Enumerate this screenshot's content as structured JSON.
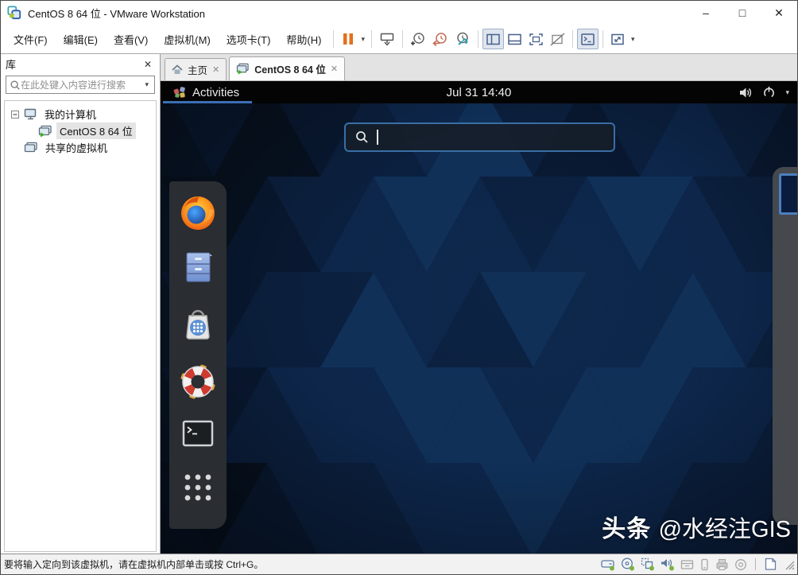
{
  "window": {
    "title": "CentOS 8 64 位 - VMware Workstation",
    "min_glyph": "–",
    "max_glyph": "□",
    "close_glyph": "✕"
  },
  "ui": {
    "close_glyph": "✕",
    "dropdown_glyph": "▾"
  },
  "menubar": {
    "items": [
      {
        "label": "文件(F)"
      },
      {
        "label": "编辑(E)"
      },
      {
        "label": "查看(V)"
      },
      {
        "label": "虚拟机(M)"
      },
      {
        "label": "选项卡(T)"
      },
      {
        "label": "帮助(H)"
      }
    ]
  },
  "library": {
    "title": "库",
    "search_placeholder": "在此处键入内容进行搜索",
    "tree": [
      {
        "label": "我的计算机",
        "level": 0,
        "expanded": true
      },
      {
        "label": "CentOS 8 64 位",
        "level": 1,
        "state": "running",
        "selected": true
      },
      {
        "label": "共享的虚拟机",
        "level": 0
      }
    ]
  },
  "tabs": [
    {
      "label": "主页",
      "active": false
    },
    {
      "label": "CentOS 8 64 位",
      "active": true
    }
  ],
  "gnome": {
    "activities_label": "Activities",
    "clock": "Jul 31 14:40",
    "search_value": "",
    "dash_items": [
      "firefox",
      "files",
      "software",
      "help",
      "terminal",
      "app-grid"
    ],
    "workspaces_visible": 1
  },
  "watermark": {
    "prefix": "头条 ",
    "handle": "@水经注GIS"
  },
  "statusbar": {
    "hint": "要将输入定向到该虚拟机，请在虚拟机内部单击或按 Ctrl+G。",
    "device_icons": [
      "hard-disk",
      "cd-rom",
      "network-adapter",
      "sound",
      "removable-tray",
      "usb-device",
      "printer",
      "disc"
    ],
    "connected_devices": [
      "hard-disk",
      "cd-rom",
      "network-adapter",
      "sound"
    ]
  },
  "icons": {
    "titlebar": "vmware-logo",
    "toolbar": [
      "pause",
      "send-ctrl-alt-del",
      "take-snapshot",
      "revert-snapshot",
      "manage-snapshots",
      "show-library",
      "show-thumbnail-bar",
      "fullscreen",
      "unity",
      "show-console",
      "fit-guest"
    ],
    "gnome_topbar": [
      "distro-badge",
      "volume",
      "power",
      "menu-chevron"
    ]
  },
  "colors": {
    "accent_blue": "#3c6eb4",
    "pause_orange": "#e2711d",
    "green_indicator": "#7cb342",
    "gnome_topbar_bg": "#040404",
    "desktop_base": "#081426",
    "dash_bg": "#2b2e33"
  }
}
